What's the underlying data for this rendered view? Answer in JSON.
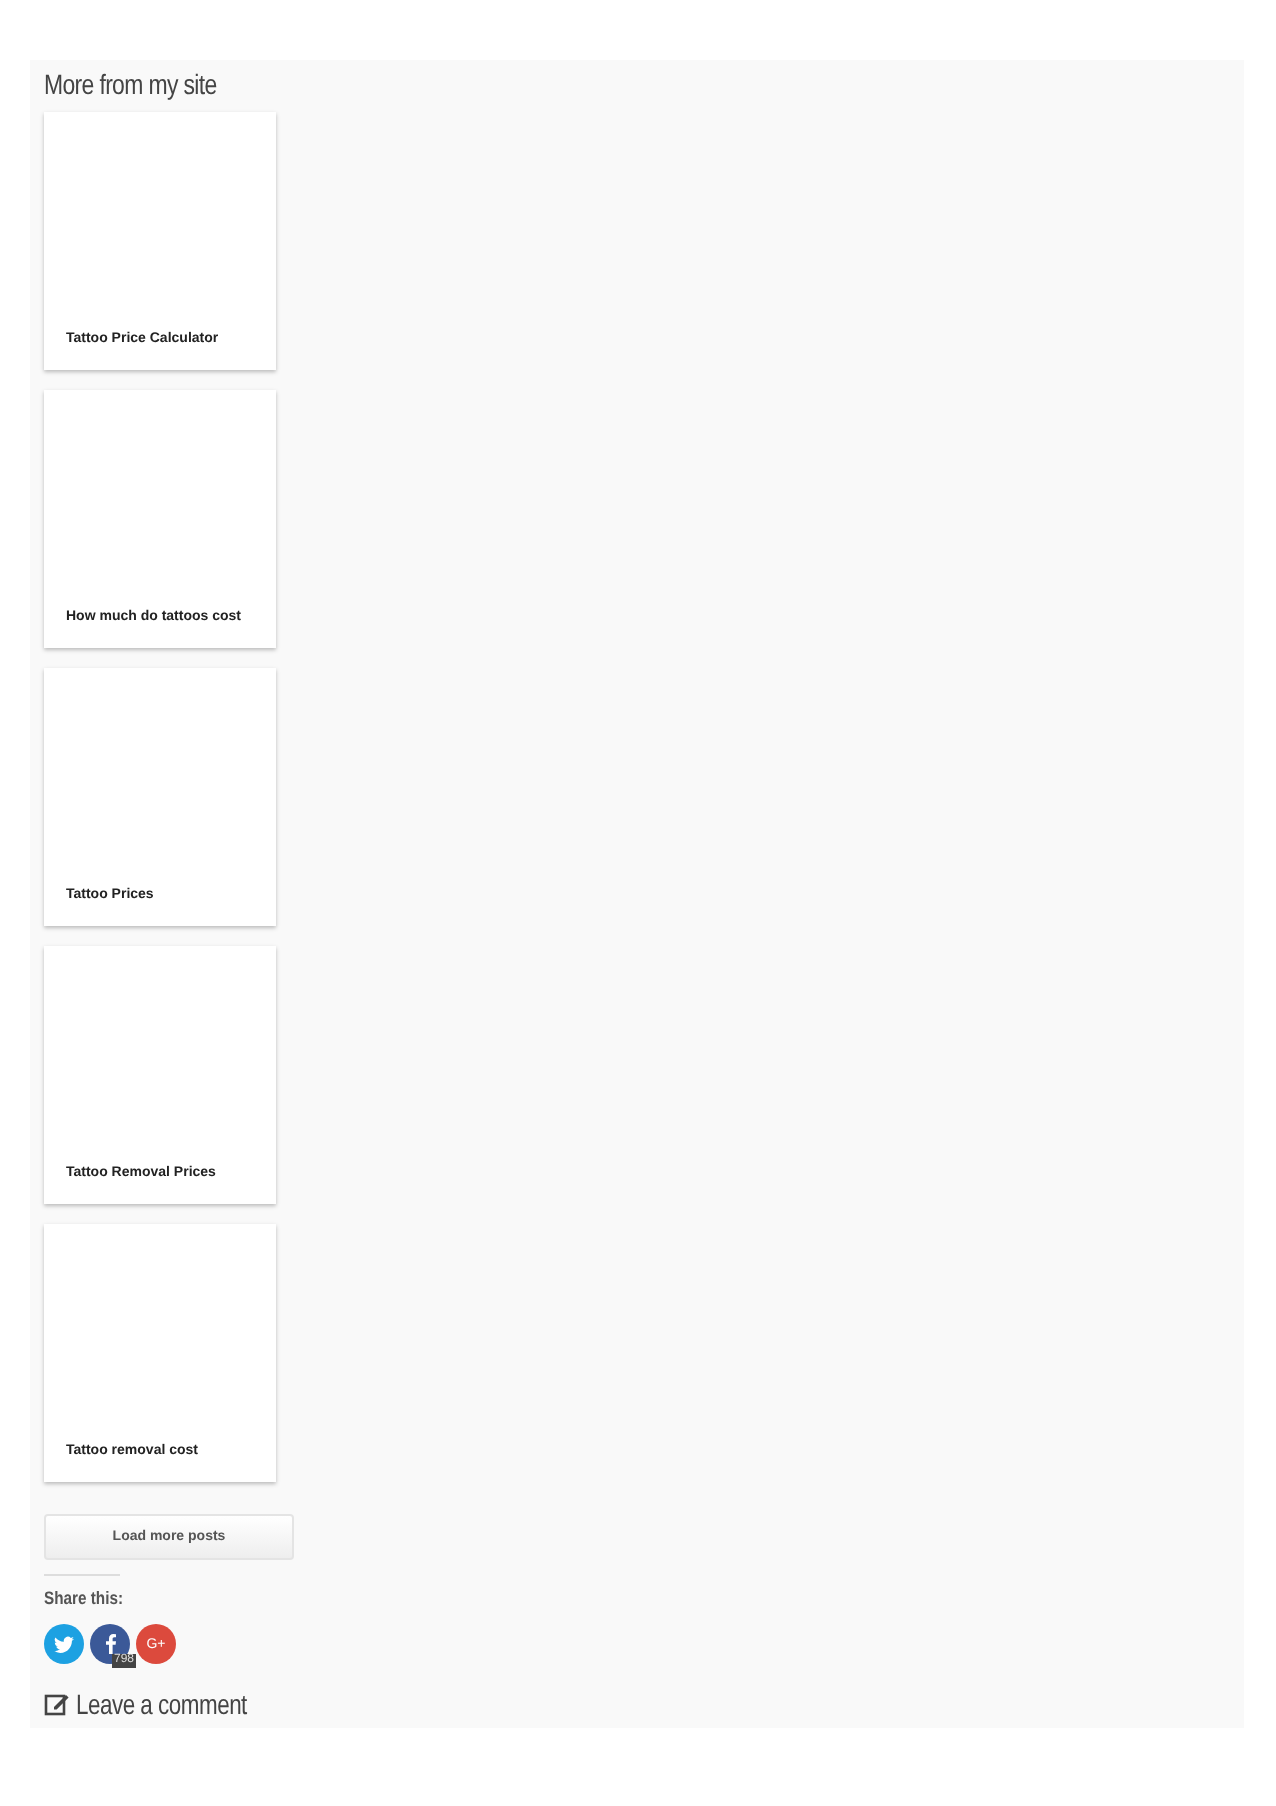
{
  "section_title": "More from my site",
  "posts": [
    {
      "title": "Tattoo Price Calculator"
    },
    {
      "title": "How much do tattoos cost"
    },
    {
      "title": "Tattoo Prices"
    },
    {
      "title": "Tattoo Removal Prices"
    },
    {
      "title": "Tattoo removal cost"
    }
  ],
  "load_more_button": "Load more posts",
  "share": {
    "label": "Share this:",
    "buttons": [
      {
        "kind": "twitter",
        "color": "#1da1e2"
      },
      {
        "kind": "facebook",
        "color": "#3b5998",
        "count": "798"
      },
      {
        "kind": "google",
        "color": "#dc4a3d",
        "label": "G+"
      }
    ]
  },
  "comment_link": "Leave a comment"
}
